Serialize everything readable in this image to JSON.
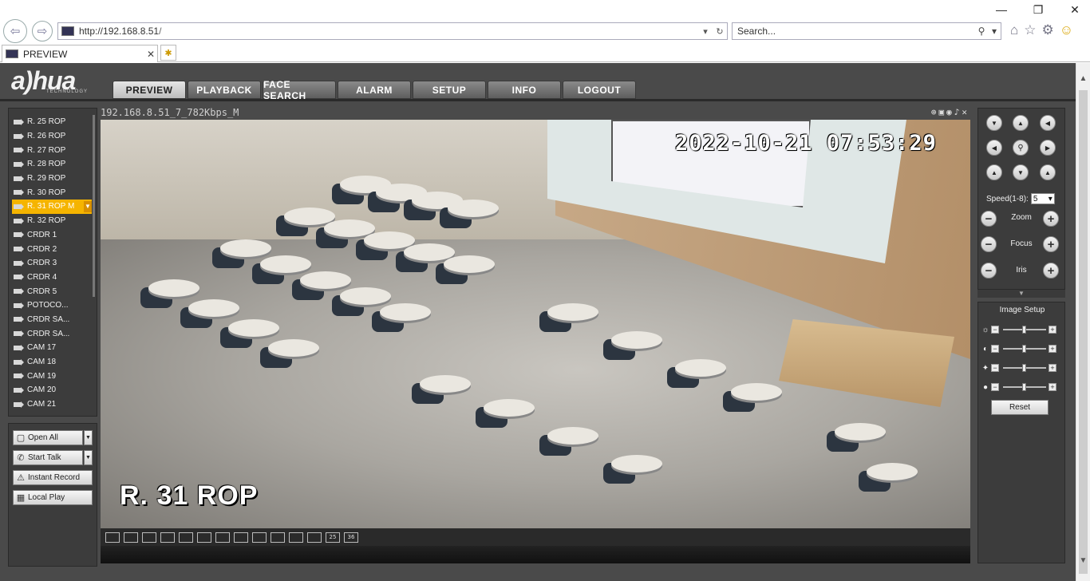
{
  "browser": {
    "url_host": "http://192.168.8.51",
    "url_path": "/",
    "search_placeholder": "Search...",
    "tab_title": "PREVIEW"
  },
  "app": {
    "logo": "a)hua",
    "logo_sub": "TECHNOLOGY",
    "nav": [
      "PREVIEW",
      "PLAYBACK",
      "FACE SEARCH",
      "ALARM",
      "SETUP",
      "INFO",
      "LOGOUT"
    ],
    "active_nav": "PREVIEW"
  },
  "channels": {
    "items": [
      "R. 25 ROP",
      "R. 26 ROP",
      "R. 27 ROP",
      "R. 28 ROP",
      "R. 29 ROP",
      "R. 30 ROP",
      "R. 31 ROP  M",
      "R. 32 ROP",
      "CRDR 1",
      "CRDR 2",
      "CRDR 3",
      "CRDR 4",
      "CRDR 5",
      "POTOCO...",
      "CRDR SA...",
      "CRDR SA...",
      "CAM 17",
      "CAM 18",
      "CAM 19",
      "CAM 20",
      "CAM 21"
    ],
    "selected_index": 6
  },
  "controls": {
    "open_all": "Open All",
    "start_talk": "Start Talk",
    "instant_record": "Instant Record",
    "local_play": "Local Play"
  },
  "video": {
    "stream_label": "192.168.8.51_7_782Kbps_M",
    "timestamp": "2022-10-21  07:53:29",
    "channel_name": "R. 31 ROP"
  },
  "layout_buttons": [
    "",
    "",
    "",
    "",
    "",
    "",
    "",
    "",
    "",
    "",
    "",
    "",
    "25",
    "36"
  ],
  "ptz": {
    "speed_label": "Speed(1-8):",
    "speed_value": "5",
    "zoom_label": "Zoom",
    "focus_label": "Focus",
    "iris_label": "Iris"
  },
  "image_setup": {
    "title": "Image Setup",
    "reset_label": "Reset"
  },
  "colors": {
    "accent": "#f5b400",
    "app_bg": "#4a4a4a",
    "panel_bg": "#3c3c3c"
  }
}
